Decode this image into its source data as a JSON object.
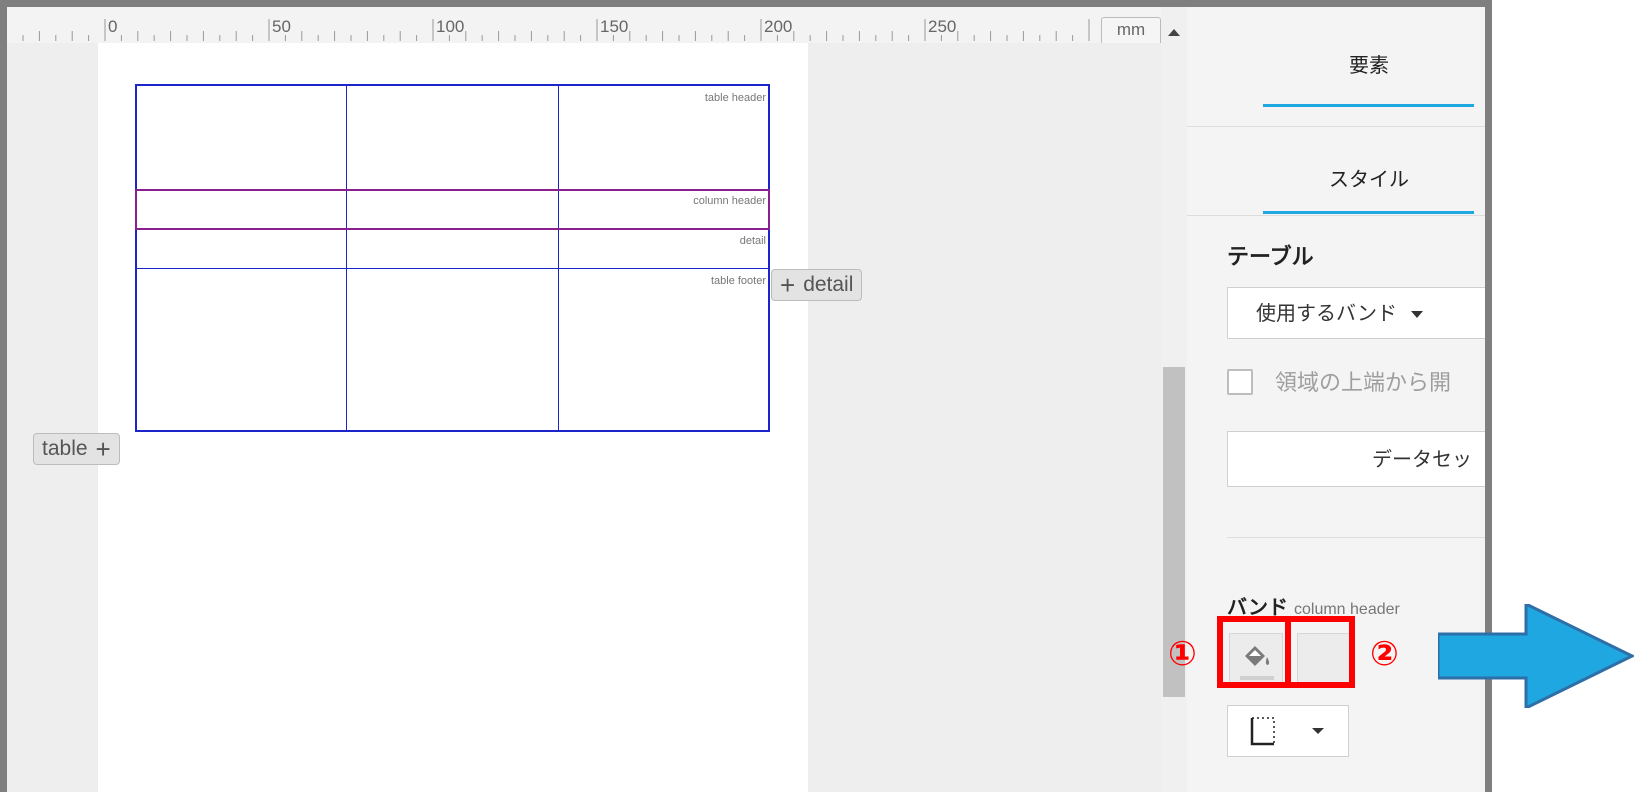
{
  "ruler": {
    "labels": [
      "0",
      "50",
      "100",
      "150",
      "200",
      "250"
    ],
    "unit": "mm"
  },
  "report": {
    "bands": {
      "table_header": "table header",
      "column_header": "column header",
      "detail": "detail",
      "table_footer": "table footer"
    },
    "add_detail": "detail",
    "add_table": "table"
  },
  "panel": {
    "tabs": [
      {
        "label": "要素"
      },
      {
        "label": "スタイル"
      }
    ],
    "section_title": "テーブル",
    "use_band_dropdown": "使用するバンド",
    "checkbox_label": "領域の上端から開",
    "dataset_button": "データセッ",
    "band_title": "バンド",
    "band_subtitle": "column header"
  },
  "annotations": {
    "marker_1": "①",
    "marker_2": "②",
    "accent_color": "#ff0000",
    "arrow_color": "#1ea7e1"
  }
}
